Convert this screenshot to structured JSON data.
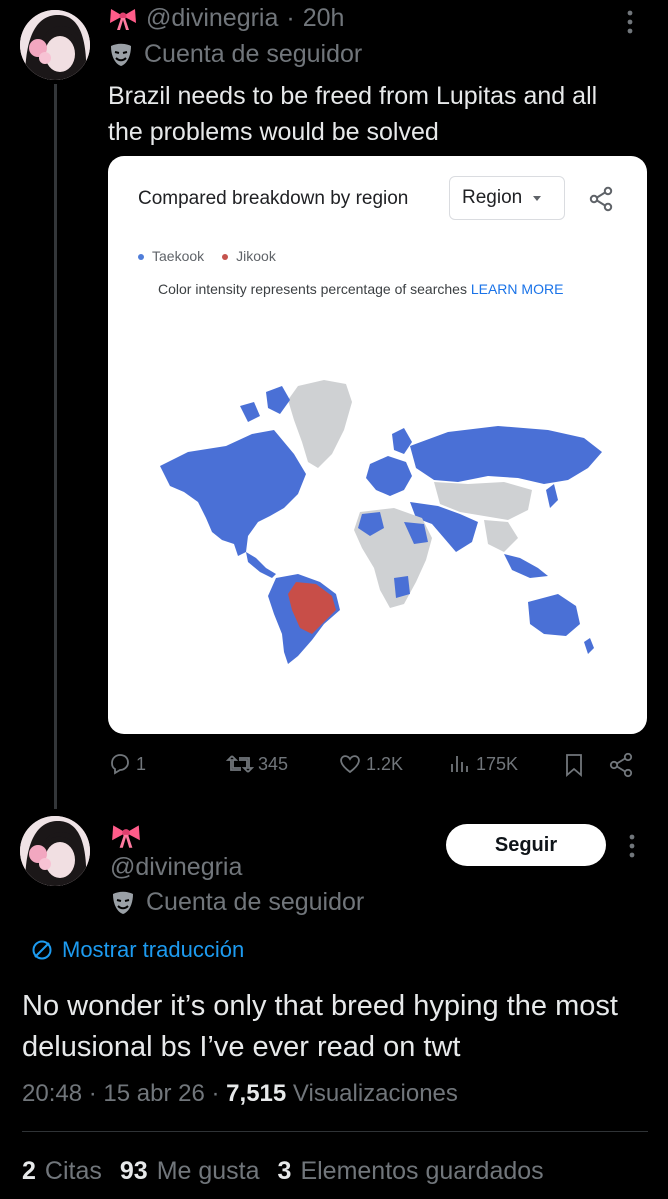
{
  "reply_to_post": {
    "handle": "@divinegria",
    "time": "20h",
    "account_label": "Cuenta de seguidor",
    "text": "Brazil needs to be freed from Lupitas and all the problems would be solved",
    "embedded_image": {
      "title": "Compared breakdown by region",
      "dropdown_value": "Region",
      "legend": [
        {
          "label": "Taekook",
          "color": "#4f7dd9"
        },
        {
          "label": "Jikook",
          "color": "#c5534d"
        }
      ],
      "note": "Color intensity represents percentage of searches",
      "learn_more": "LEARN MORE",
      "map_colors": {
        "blue": "#4a70d6",
        "red": "#c84e48",
        "gray": "#cfd1d3"
      }
    },
    "actions": {
      "replies": "1",
      "reposts": "345",
      "likes": "1.2K",
      "views": "175K"
    }
  },
  "main_post": {
    "handle": "@divinegria",
    "account_label": "Cuenta de seguidor",
    "follow_label": "Seguir",
    "translate_label": "Mostrar traducción",
    "text": "No wonder it’s only that breed hyping the most delusional bs I’ve ever read on twt",
    "time": "20:48",
    "date": "15 abr 26",
    "views_count": "7,515",
    "views_label": "Visualizaciones",
    "separator": "·",
    "stats": {
      "quotes_count": "2",
      "quotes_label": "Citas",
      "likes_count": "93",
      "likes_label": "Me gusta",
      "bookmarks_count": "3",
      "bookmarks_label": "Elementos guardados"
    }
  },
  "accent_color": "#1d9bf0"
}
